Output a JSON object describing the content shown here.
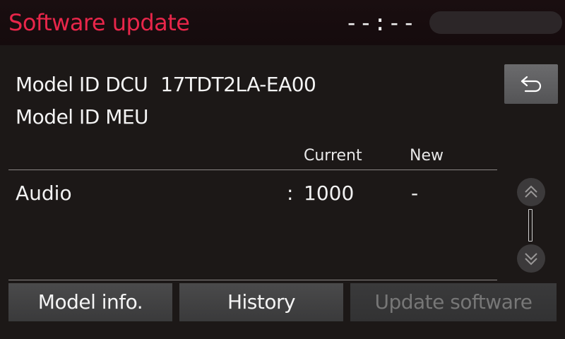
{
  "header": {
    "title": "Software update",
    "clock": "--:--"
  },
  "model": {
    "dcu_label": "Model ID DCU",
    "dcu_value": "17TDT2LA-EA00",
    "meu_label": "Model ID MEU"
  },
  "table": {
    "head_current": "Current",
    "head_new": "New",
    "rows": [
      {
        "label": "Audio",
        "separator": ":",
        "current": "1000",
        "new": "-"
      }
    ]
  },
  "footer": {
    "model_info": "Model info.",
    "history": "History",
    "update_software": "Update software"
  },
  "icons": {
    "back": "back-arrow-icon",
    "scroll_up": "double-chevron-up-icon",
    "scroll_down": "double-chevron-down-icon"
  },
  "colors": {
    "title": "#e8264a",
    "background": "#1c1817",
    "button": "#4a4a4b",
    "disabled_text": "#777777"
  }
}
